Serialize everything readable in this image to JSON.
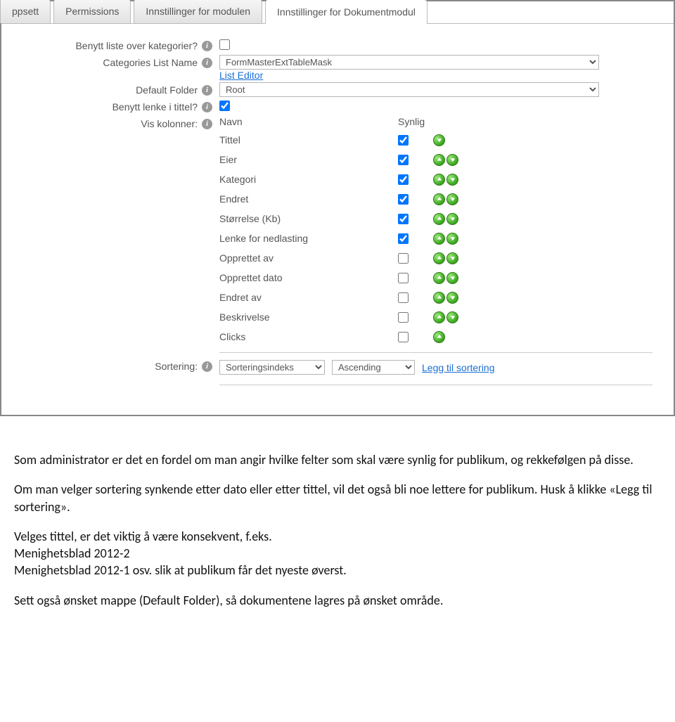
{
  "tabs": [
    {
      "label": "ppsett"
    },
    {
      "label": "Permissions"
    },
    {
      "label": "Innstillinger for modulen"
    },
    {
      "label": "Innstillinger for Dokumentmodul",
      "active": true
    }
  ],
  "form": {
    "use_categories_label": "Benytt liste over kategorier?",
    "categories_list_name_label": "Categories List Name",
    "categories_list_name_value": "FormMasterExtTableMask",
    "list_editor_link": "List Editor",
    "default_folder_label": "Default Folder",
    "default_folder_value": "Root",
    "use_link_title_label": "Benytt lenke i tittel?",
    "vis_kolonner_label": "Vis kolonner:",
    "col_name_header": "Navn",
    "col_visible_header": "Synlig",
    "columns": [
      {
        "name": "Tittel",
        "checked": true,
        "up": false,
        "down": true
      },
      {
        "name": "Eier",
        "checked": true,
        "up": true,
        "down": true
      },
      {
        "name": "Kategori",
        "checked": true,
        "up": true,
        "down": true
      },
      {
        "name": "Endret",
        "checked": true,
        "up": true,
        "down": true
      },
      {
        "name": "Størrelse (Kb)",
        "checked": true,
        "up": true,
        "down": true
      },
      {
        "name": "Lenke for nedlasting",
        "checked": true,
        "up": true,
        "down": true
      },
      {
        "name": "Opprettet av",
        "checked": false,
        "up": true,
        "down": true
      },
      {
        "name": "Opprettet dato",
        "checked": false,
        "up": true,
        "down": true
      },
      {
        "name": "Endret av",
        "checked": false,
        "up": true,
        "down": true
      },
      {
        "name": "Beskrivelse",
        "checked": false,
        "up": true,
        "down": true
      },
      {
        "name": "Clicks",
        "checked": false,
        "up": true,
        "down": false
      }
    ],
    "sortering_label": "Sortering:",
    "sortering_field": "Sorteringsindeks",
    "sortering_dir": "Ascending",
    "add_sort_link": "Legg til sortering"
  },
  "doc": {
    "p1": "Som administrator er det en fordel om man angir hvilke felter som skal være synlig for publikum, og rekkefølgen på disse.",
    "p2": "Om man velger sortering synkende etter dato eller etter tittel, vil det også bli noe lettere for publikum. Husk å klikke «Legg til sortering».",
    "p3": "Velges tittel, er det viktig å være konsekvent, f.eks.",
    "p4": "Menighetsblad 2012-2",
    "p5": "Menighetsblad 2012-1 osv. slik at publikum får det nyeste øverst.",
    "p6": "Sett også ønsket mappe (Default Folder), så dokumentene lagres på ønsket område."
  }
}
